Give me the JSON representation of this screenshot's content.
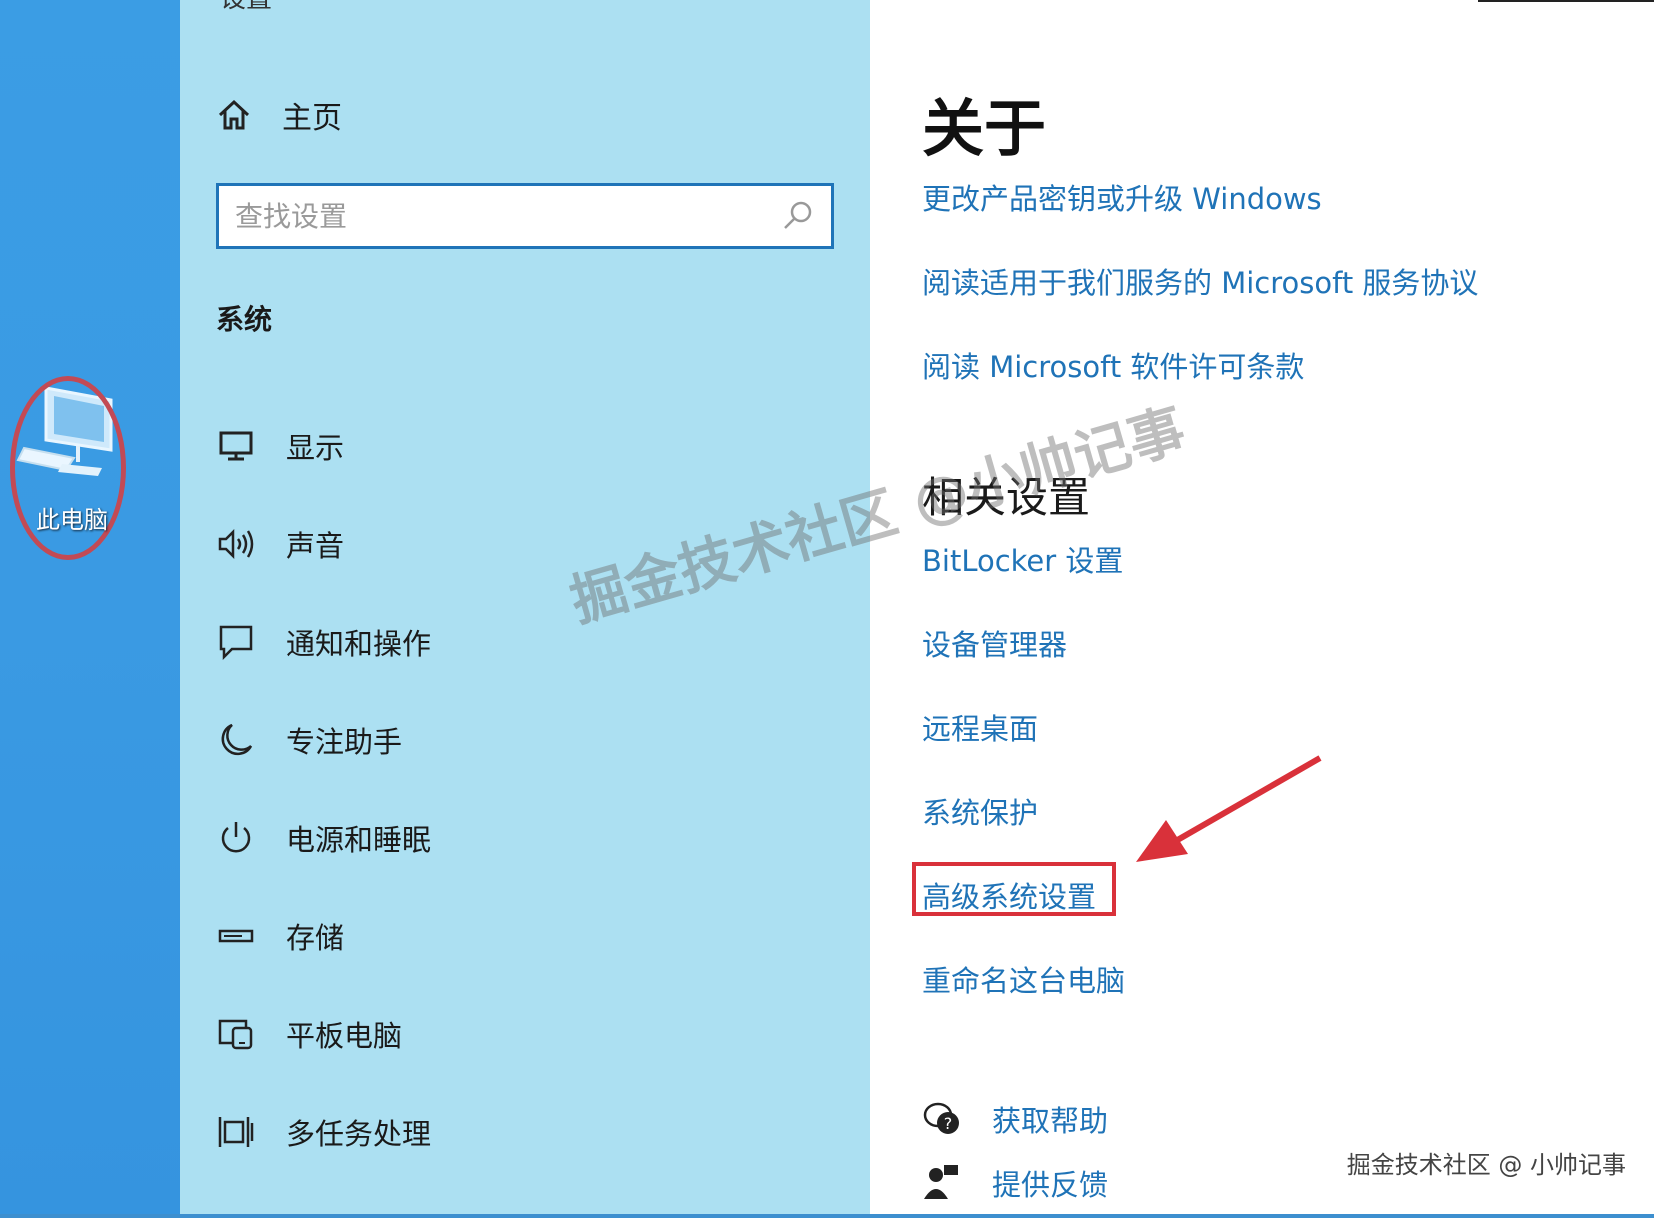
{
  "desktop": {
    "pc_label": "此电脑"
  },
  "nav": {
    "top_label": "设置",
    "home_label": "主页",
    "search_placeholder": "查找设置",
    "section_label": "系统",
    "items": [
      {
        "label": "显示",
        "icon": "monitor-icon"
      },
      {
        "label": "声音",
        "icon": "speaker-icon"
      },
      {
        "label": "通知和操作",
        "icon": "notification-icon"
      },
      {
        "label": "专注助手",
        "icon": "moon-icon"
      },
      {
        "label": "电源和睡眠",
        "icon": "power-icon"
      },
      {
        "label": "存储",
        "icon": "storage-icon"
      },
      {
        "label": "平板电脑",
        "icon": "tablet-icon"
      },
      {
        "label": "多任务处理",
        "icon": "multitask-icon"
      }
    ]
  },
  "content": {
    "title": "关于",
    "about_links": [
      "更改产品密钥或升级 Windows",
      "阅读适用于我们服务的 Microsoft 服务协议",
      "阅读 Microsoft 软件许可条款"
    ],
    "related_title": "相关设置",
    "related_links": [
      "BitLocker 设置",
      "设备管理器",
      "远程桌面",
      "系统保护",
      "高级系统设置",
      "重命名这台电脑"
    ],
    "help_label": "获取帮助",
    "feedback_label": "提供反馈"
  },
  "overlay": {
    "watermark": "掘金技术社区 @小帅记事",
    "corner_watermark": "掘金技术社区 @ 小帅记事"
  },
  "colors": {
    "desktop_blue": "#3a9ae3",
    "nav_bg": "#ace0f2",
    "link_blue": "#1f73b7",
    "highlight_red": "#d9313a"
  }
}
